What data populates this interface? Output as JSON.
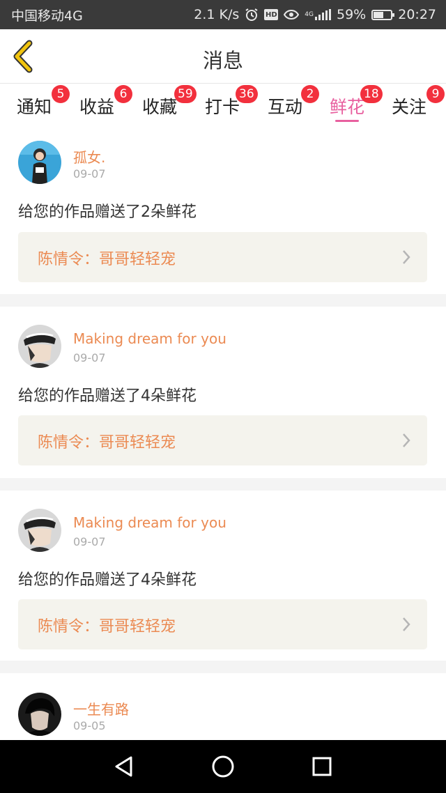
{
  "status_bar": {
    "carrier": "中国移动4G",
    "net_speed": "2.1 K/s",
    "alarm_icon": "alarm-clock-icon",
    "hd_label": "HD",
    "eye_icon": "eye-comfort-icon",
    "network_type": "4G",
    "battery_percent": "59%",
    "battery_level": 0.59,
    "time": "20:27"
  },
  "header": {
    "title": "消息",
    "back_icon": "chevron-left-icon",
    "accent_color": "#f1c40f"
  },
  "tabs": [
    {
      "label": "通知",
      "badge": "5"
    },
    {
      "label": "收益",
      "badge": "6"
    },
    {
      "label": "收藏",
      "badge": "59"
    },
    {
      "label": "打卡",
      "badge": "36"
    },
    {
      "label": "互动",
      "badge": "2"
    },
    {
      "label": "鲜花",
      "badge": "18",
      "active": true
    },
    {
      "label": "关注",
      "badge": "9"
    }
  ],
  "colors": {
    "active_tab": "#e8609f",
    "badge": "#f2303d",
    "username": "#eb8a52",
    "work_box_bg": "#f4f3ed"
  },
  "feed": [
    {
      "username": "孤女.",
      "date": "09-07",
      "message": "给您的作品赠送了2朵鲜花",
      "work_title": "陈情令：哥哥轻轻宠"
    },
    {
      "username": "Making dream for you",
      "date": "09-07",
      "message": "给您的作品赠送了4朵鲜花",
      "work_title": "陈情令：哥哥轻轻宠"
    },
    {
      "username": "Making dream for you",
      "date": "09-07",
      "message": "给您的作品赠送了4朵鲜花",
      "work_title": "陈情令：哥哥轻轻宠"
    },
    {
      "username": "一生有路",
      "date": "09-05"
    }
  ],
  "nav_bar": {
    "back_icon": "triangle-back-icon",
    "home_icon": "circle-home-icon",
    "recents_icon": "square-recents-icon"
  }
}
